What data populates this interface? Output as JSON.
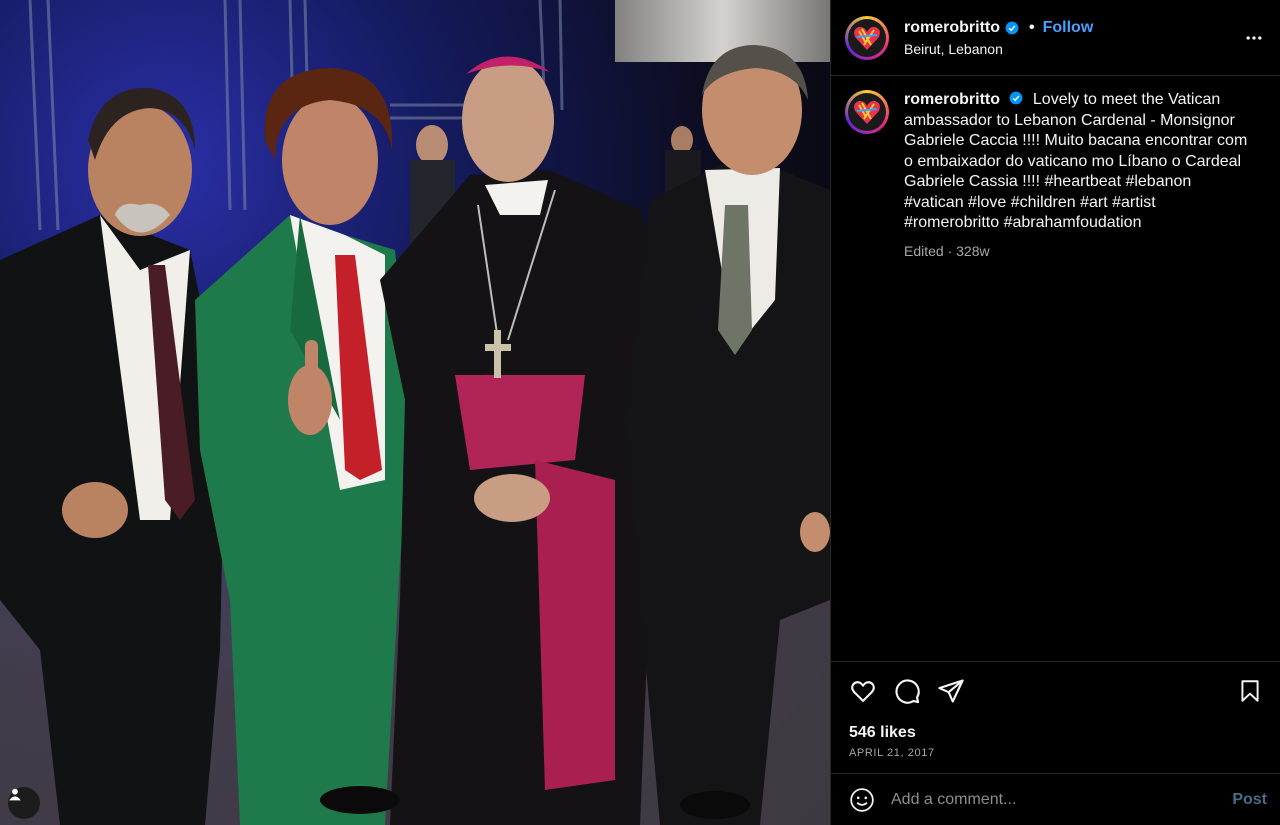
{
  "post": {
    "username": "romerobritto",
    "verified": true,
    "follow_label": "Follow",
    "separator": "•",
    "location": "Beirut, Lebanon"
  },
  "caption": {
    "username": "romerobritto",
    "text": "Lovely to meet the Vatican ambassador to Lebanon Cardenal - Monsignor Gabriele Caccia !!!! Muito bacana encontrar com o embaixador do vaticano mo Líbano o Cardeal Gabriele Cassia !!!! #heartbeat #lebanon #vatican #love #children #art #artist #romerobritto #abrahamfoudation",
    "meta": "Edited · 328w"
  },
  "engagement": {
    "likes": "546 likes",
    "date": "APRIL 21, 2017"
  },
  "comment_box": {
    "placeholder": "Add a comment...",
    "post_label": "Post"
  },
  "icons": {
    "like": "heart-icon",
    "comment": "comment-bubble-icon",
    "share": "paper-plane-icon",
    "save": "bookmark-icon",
    "more": "more-dots-icon",
    "emoji": "emoji-icon",
    "verified": "verified-badge-icon",
    "user": "user-tag-icon"
  },
  "colors": {
    "background": "#000000",
    "accent": "#4a9eff",
    "muted_text": "#a8a8a8",
    "post_button": "#4a6a8a"
  }
}
